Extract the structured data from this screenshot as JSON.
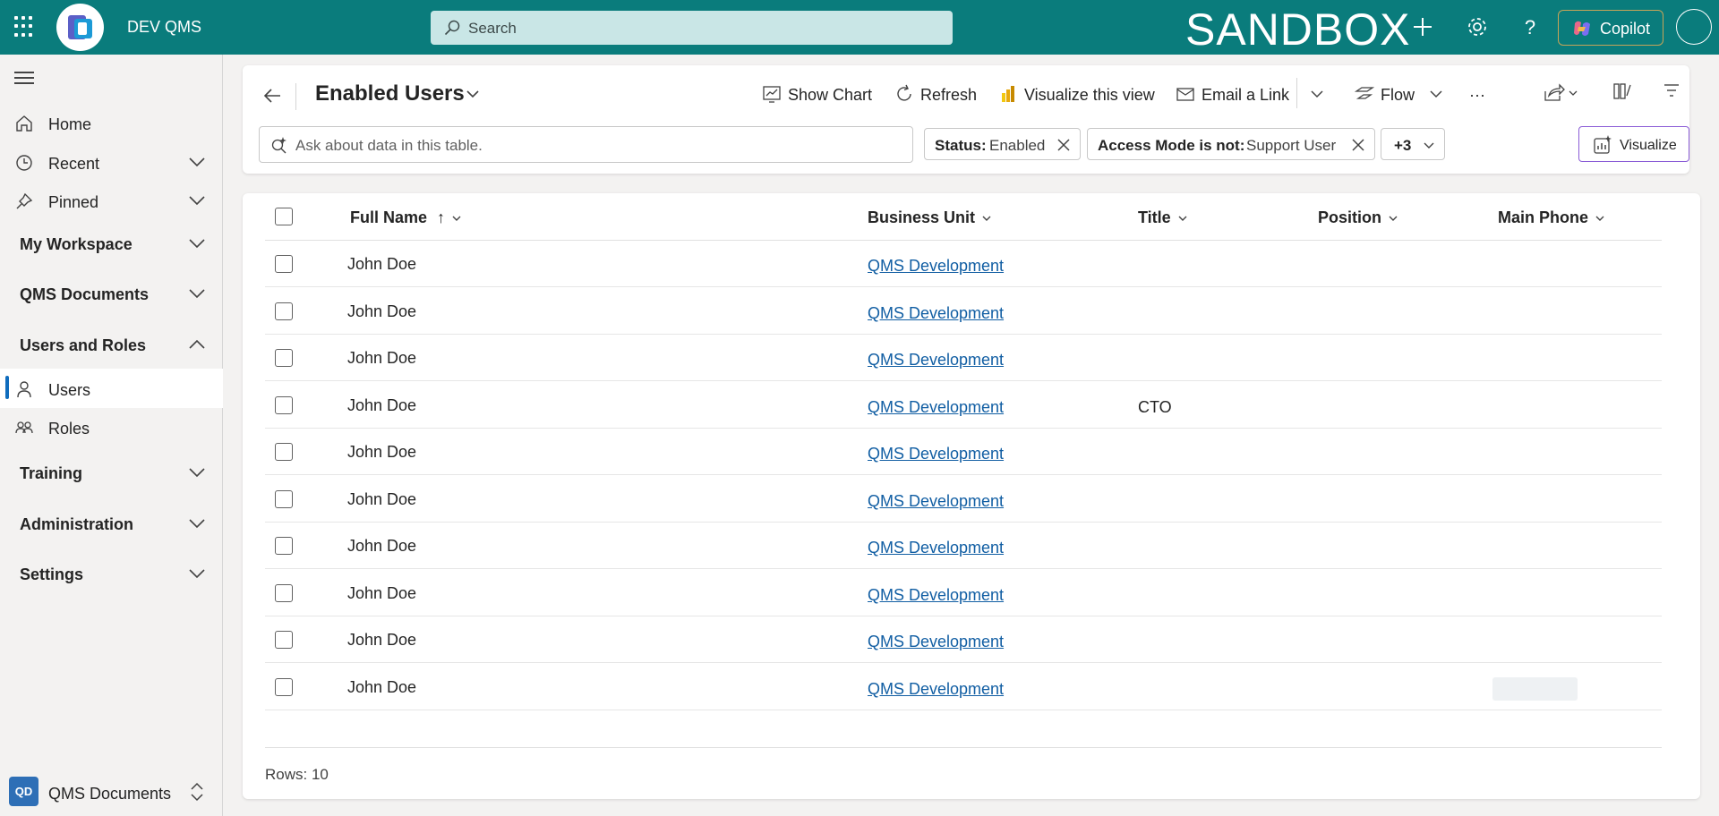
{
  "topbar": {
    "app_name": "DEV QMS",
    "search_placeholder": "Search",
    "environment": "SANDBOX",
    "copilot_label": "Copilot",
    "brand_color": "#0a7c7c"
  },
  "sidebar": {
    "items": [
      {
        "label": "Home",
        "icon": "home-icon"
      },
      {
        "label": "Recent",
        "icon": "clock-icon"
      },
      {
        "label": "Pinned",
        "icon": "pin-icon"
      }
    ],
    "groups": [
      {
        "label": "My Workspace"
      },
      {
        "label": "QMS Documents"
      },
      {
        "label": "Users and Roles"
      },
      {
        "label": "Training"
      },
      {
        "label": "Administration"
      },
      {
        "label": "Settings"
      }
    ],
    "sub_items": [
      {
        "label": "Users",
        "icon": "person-icon",
        "active": true
      },
      {
        "label": "Roles",
        "icon": "people-icon"
      }
    ],
    "area": {
      "badge": "QD",
      "label": "QMS Documents"
    }
  },
  "commandbar": {
    "view_title": "Enabled Users",
    "show_chart": "Show Chart",
    "refresh": "Refresh",
    "visualize_view": "Visualize this view",
    "email_link": "Email a Link",
    "flow": "Flow",
    "more": "···"
  },
  "filters": {
    "ask_placeholder": "Ask about data in this table.",
    "chips": [
      {
        "key": "Status:",
        "value": "Enabled"
      },
      {
        "key": "Access Mode is not:",
        "value": "Support User"
      }
    ],
    "more_label": "+3",
    "visualize_button": "Visualize"
  },
  "grid": {
    "columns": [
      "Full Name",
      "Business Unit",
      "Title",
      "Position",
      "Main Phone"
    ],
    "sort_indicator": "↑",
    "rows": [
      {
        "full_name": "John Doe",
        "business_unit": "QMS Development",
        "title": "",
        "position": "",
        "main_phone": ""
      },
      {
        "full_name": "John Doe",
        "business_unit": "QMS Development",
        "title": "",
        "position": "",
        "main_phone": ""
      },
      {
        "full_name": "John Doe",
        "business_unit": "QMS Development",
        "title": "",
        "position": "",
        "main_phone": ""
      },
      {
        "full_name": "John Doe",
        "business_unit": "QMS Development",
        "title": "CTO",
        "position": "",
        "main_phone": ""
      },
      {
        "full_name": "John Doe",
        "business_unit": "QMS Development",
        "title": "",
        "position": "",
        "main_phone": ""
      },
      {
        "full_name": "John Doe",
        "business_unit": "QMS Development",
        "title": "",
        "position": "",
        "main_phone": ""
      },
      {
        "full_name": "John Doe",
        "business_unit": "QMS Development",
        "title": "",
        "position": "",
        "main_phone": ""
      },
      {
        "full_name": "John Doe",
        "business_unit": "QMS Development",
        "title": "",
        "position": "",
        "main_phone": ""
      },
      {
        "full_name": "John Doe",
        "business_unit": "QMS Development",
        "title": "",
        "position": "",
        "main_phone": ""
      },
      {
        "full_name": "John Doe",
        "business_unit": "QMS Development",
        "title": "",
        "position": "",
        "main_phone": ""
      }
    ],
    "footer": "Rows: 10"
  }
}
